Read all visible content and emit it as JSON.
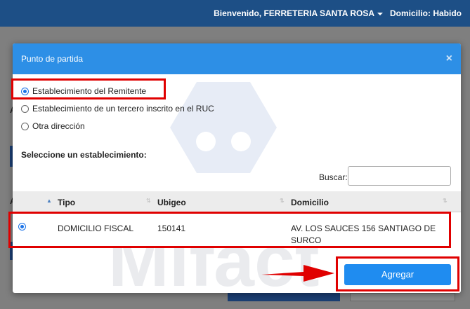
{
  "navbar": {
    "welcome": "Bienvenido, FERRETERIA SANTA ROSA",
    "domicilio": "Domicilio: Habido"
  },
  "modal": {
    "title": "Punto de partida",
    "close_symbol": "×",
    "radio_options": [
      {
        "label": "Establecimiento del Remitente",
        "checked": true
      },
      {
        "label": "Establecimiento de un tercero inscrito en el RUC",
        "checked": false
      },
      {
        "label": "Otra dirección",
        "checked": false
      }
    ],
    "section_label": "Seleccione un establecimiento:",
    "search_label": "Buscar:",
    "search_value": "",
    "table": {
      "columns": [
        "Tipo",
        "Ubigeo",
        "Domicilio"
      ],
      "sorted_column": "Tipo",
      "rows": [
        {
          "selected": true,
          "tipo": "DOMICILIO FISCAL",
          "ubigeo": "150141",
          "domicilio_line1": "AV. LOS SAUCES 156 SANTIAGO DE",
          "domicilio_line2": "SURCO"
        }
      ]
    },
    "agregar_label": "Agregar"
  },
  "watermark": {
    "text": "Mifact"
  },
  "colors": {
    "header": "#2d8fe6",
    "navbar": "#1d4f86",
    "button": "#1f8cf0",
    "highlight": "#e00000"
  }
}
